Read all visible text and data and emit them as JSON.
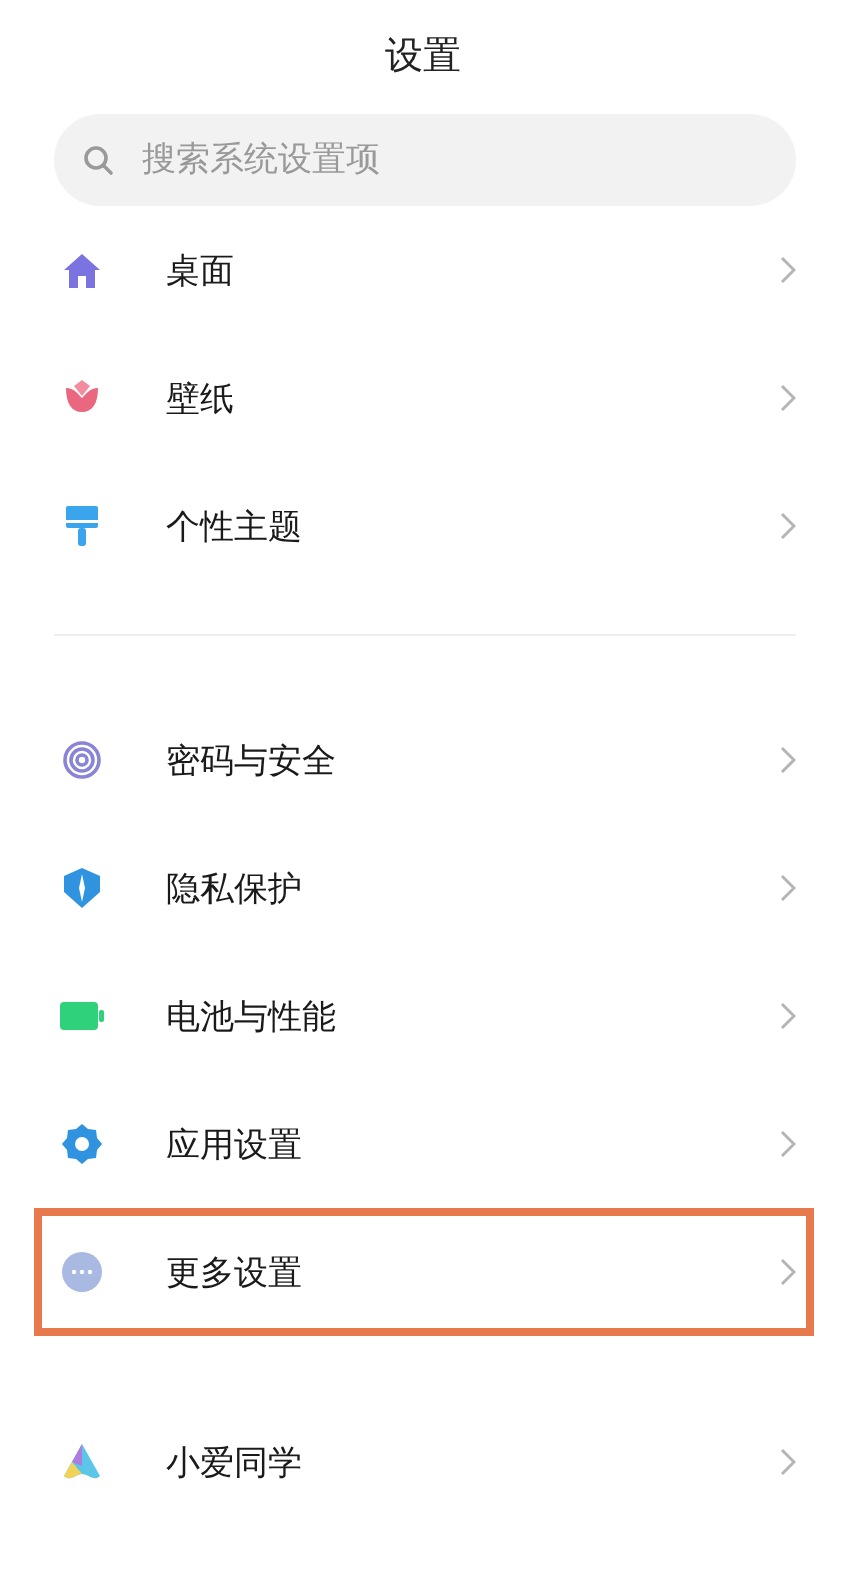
{
  "title": "设置",
  "search": {
    "placeholder": "搜索系统设置项"
  },
  "sections": [
    {
      "items": [
        {
          "label": "桌面",
          "kind": "home",
          "highlighted": false
        },
        {
          "label": "壁纸",
          "kind": "tulip",
          "highlighted": false
        },
        {
          "label": "个性主题",
          "kind": "brush",
          "highlighted": false
        }
      ]
    },
    {
      "items": [
        {
          "label": "密码与安全",
          "kind": "fingerprint",
          "highlighted": false
        },
        {
          "label": "隐私保护",
          "kind": "shield",
          "highlighted": false
        },
        {
          "label": "电池与性能",
          "kind": "battery",
          "highlighted": false
        },
        {
          "label": "应用设置",
          "kind": "gear",
          "highlighted": false
        },
        {
          "label": "更多设置",
          "kind": "dots",
          "highlighted": true
        }
      ]
    },
    {
      "items": [
        {
          "label": "小爱同学",
          "kind": "assistant",
          "highlighted": false
        }
      ]
    }
  ]
}
